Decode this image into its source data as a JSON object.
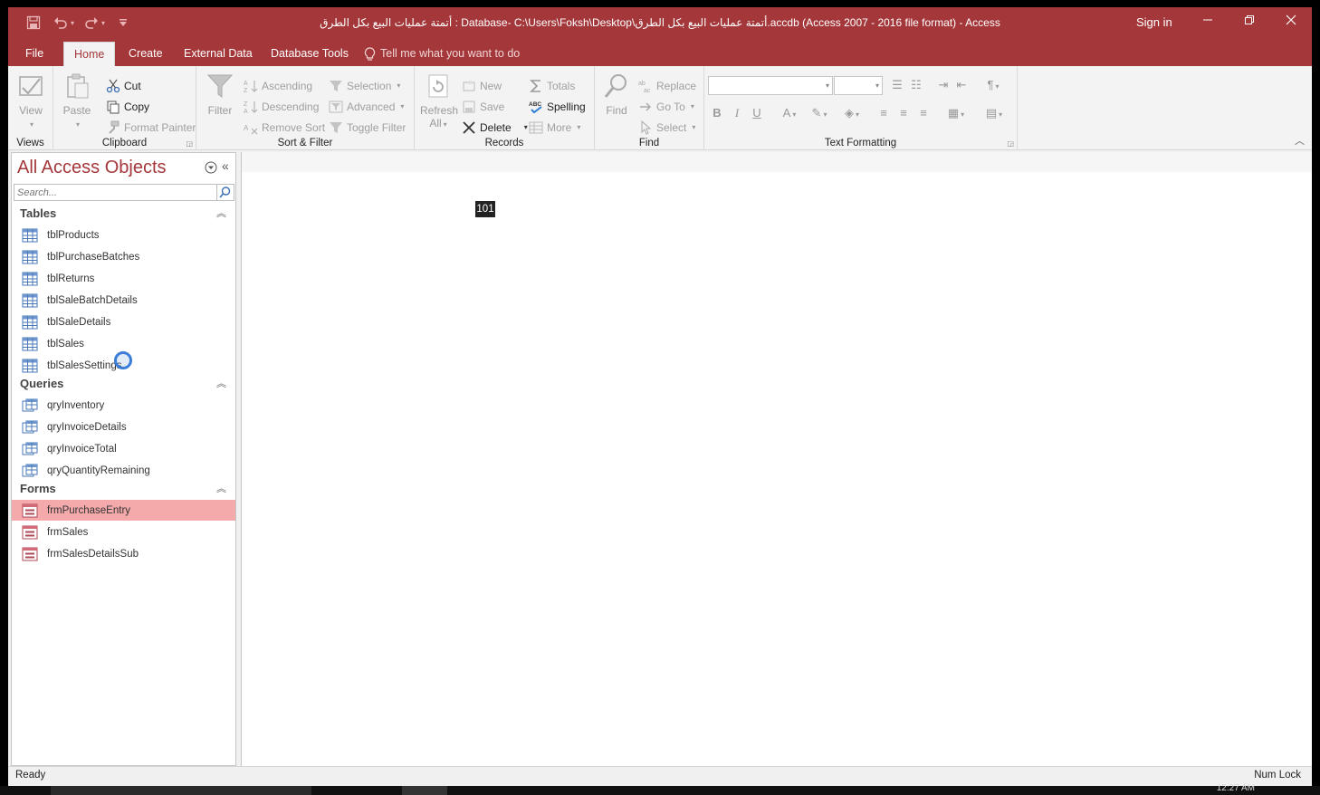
{
  "titlebar": {
    "title": "أتمتة عمليات البيع بكل الطرق : Database- C:\\Users\\Foksh\\Desktop\\أتمتة عمليات البيع بكل الطرق.accdb (Access 2007 - 2016 file format)  -  Access",
    "sign_in": "Sign in",
    "save_icon": "save-icon",
    "undo_icon": "undo-icon",
    "redo_icon": "redo-icon"
  },
  "tabs": [
    {
      "label": "File"
    },
    {
      "label": "Home"
    },
    {
      "label": "Create"
    },
    {
      "label": "External Data"
    },
    {
      "label": "Database Tools"
    }
  ],
  "tell_me": "Tell me what you want to do",
  "ribbon": {
    "views": {
      "label": "Views",
      "view": "View"
    },
    "clipboard": {
      "label": "Clipboard",
      "paste": "Paste",
      "cut": "Cut",
      "copy": "Copy",
      "format_painter": "Format Painter"
    },
    "sort_filter": {
      "label": "Sort & Filter",
      "filter": "Filter",
      "ascending": "Ascending",
      "descending": "Descending",
      "remove_sort": "Remove Sort",
      "selection": "Selection",
      "advanced": "Advanced",
      "toggle_filter": "Toggle Filter"
    },
    "records": {
      "label": "Records",
      "refresh": "Refresh",
      "refresh_all": "All",
      "new": "New",
      "save": "Save",
      "delete": "Delete",
      "totals": "Totals",
      "spelling": "Spelling",
      "more": "More"
    },
    "find": {
      "label": "Find",
      "find": "Find",
      "replace": "Replace",
      "go_to": "Go To",
      "select": "Select"
    },
    "text_formatting": {
      "label": "Text Formatting",
      "bold": "B",
      "italic": "I",
      "underline": "U"
    }
  },
  "nav": {
    "title": "All Access Objects",
    "search_placeholder": "Search...",
    "categories": [
      {
        "label": "Tables",
        "items": [
          "tblProducts",
          "tblPurchaseBatches",
          "tblReturns",
          "tblSaleBatchDetails",
          "tblSaleDetails",
          "tblSales",
          "tblSalesSettings"
        ]
      },
      {
        "label": "Queries",
        "items": [
          "qryInventory",
          "qryInvoiceDetails",
          "qryInvoiceTotal",
          "qryQuantityRemaining"
        ]
      },
      {
        "label": "Forms",
        "items": [
          "frmPurchaseEntry",
          "frmSales",
          "frmSalesDetailsSub"
        ]
      }
    ],
    "selected": "frmPurchaseEntry"
  },
  "workspace": {
    "badge": "101"
  },
  "status": {
    "left": "Ready",
    "right": "Num Lock"
  },
  "taskbar": {
    "clock": "12:27 AM"
  },
  "colors": {
    "accent": "#a4373a",
    "selected_row": "#f4a9ab"
  }
}
